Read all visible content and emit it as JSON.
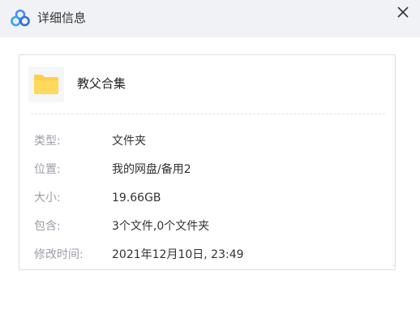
{
  "window": {
    "title": "详细信息",
    "icons": {
      "app": "baidu-netdisk-cloud-icon",
      "close": "close-icon",
      "folder": "folder-icon"
    },
    "colors": {
      "titlebar_bg": "#f1f2f5",
      "folder_yellow": "#ffce4a",
      "label_gray": "#9a9ea6",
      "value_dark": "#333333",
      "brand_blue": "#4a8cf7"
    }
  },
  "file": {
    "name": "教父合集"
  },
  "details": [
    {
      "label": "类型:",
      "value": "文件夹"
    },
    {
      "label": "位置:",
      "value": "我的网盘/备用2"
    },
    {
      "label": "大小:",
      "value": "19.66GB"
    },
    {
      "label": "包含:",
      "value": "3个文件,0个文件夹"
    },
    {
      "label": "修改时间:",
      "value": "2021年12月10日, 23:49"
    }
  ]
}
